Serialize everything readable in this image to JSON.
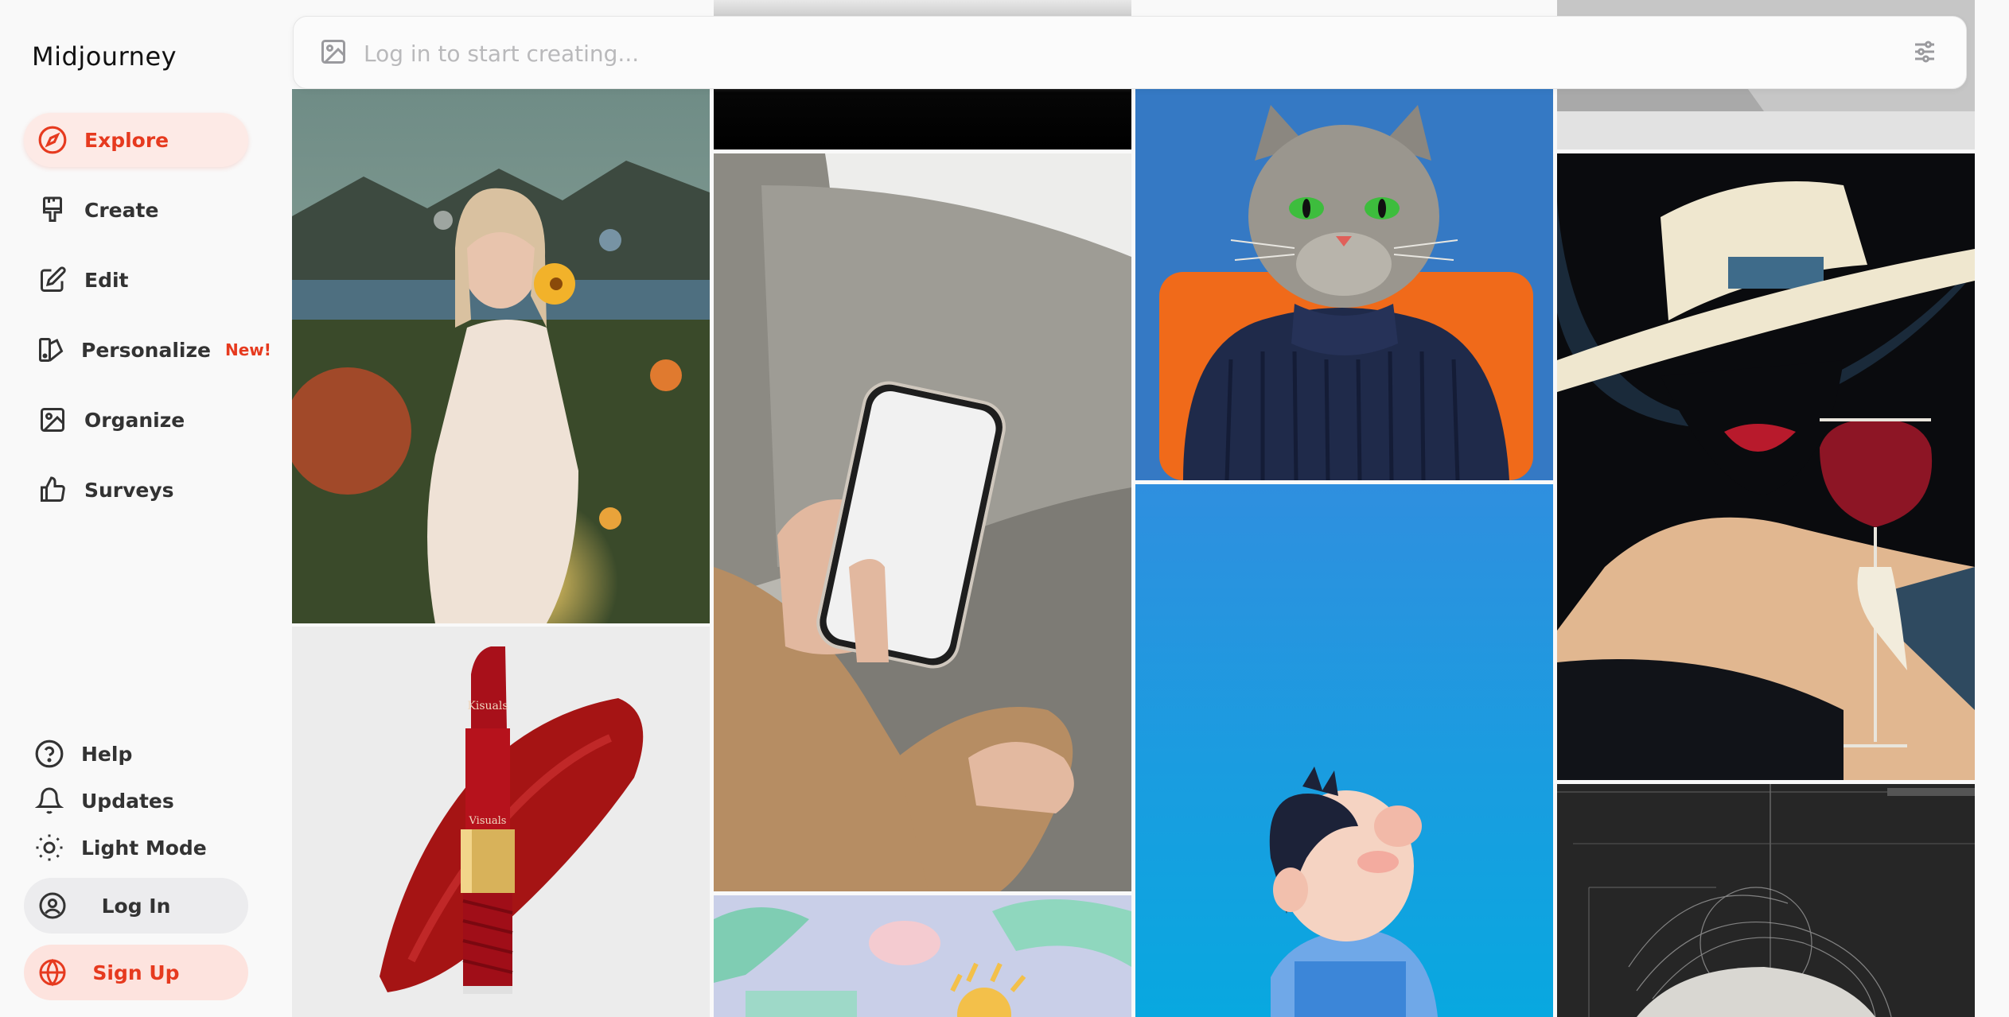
{
  "app": {
    "brand": "Midjourney"
  },
  "nav": {
    "items": [
      {
        "label": "Explore",
        "icon": "compass-icon",
        "active": true
      },
      {
        "label": "Create",
        "icon": "paintbrush-icon"
      },
      {
        "label": "Edit",
        "icon": "edit-icon"
      },
      {
        "label": "Personalize",
        "icon": "personalize-icon",
        "badge": "New!"
      },
      {
        "label": "Organize",
        "icon": "image-icon"
      },
      {
        "label": "Surveys",
        "icon": "thumbs-up-icon"
      }
    ]
  },
  "utility": {
    "help": "Help",
    "updates": "Updates",
    "light_mode": "Light Mode",
    "login": "Log In",
    "signup": "Sign Up"
  },
  "search": {
    "placeholder": "Log in to start creating..."
  },
  "colors": {
    "accent": "#e63a1f",
    "accent_bg": "#fdeae6",
    "sidebar_bg": "#f9f9f9"
  },
  "gallery": {
    "lipstick_brand": "Kisuals",
    "lipstick_brand_lower": "Visuals"
  }
}
